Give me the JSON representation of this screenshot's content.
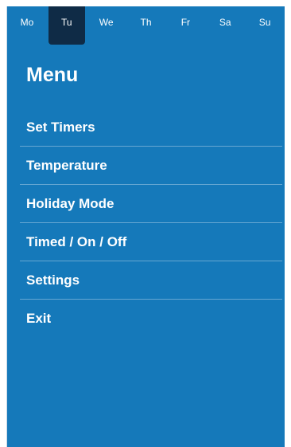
{
  "days": [
    "Mo",
    "Tu",
    "We",
    "Th",
    "Fr",
    "Sa",
    "Su"
  ],
  "selected_day": "Tu",
  "title": "Menu",
  "menu": [
    "Set Timers",
    "Temperature",
    "Holiday Mode",
    "Timed / On / Off",
    "Settings",
    "Exit"
  ],
  "colors": {
    "background": "#1579ba",
    "selected_day_bg": "#0f2b46",
    "text": "#ffffff"
  }
}
